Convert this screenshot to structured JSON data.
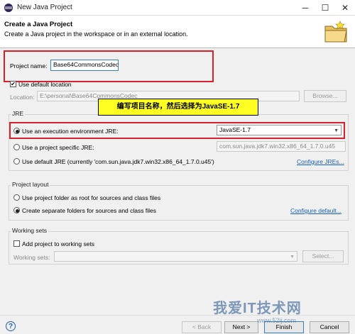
{
  "window": {
    "title": "New Java Project",
    "minimize": "─",
    "maximize": "☐",
    "close": "✕"
  },
  "header": {
    "title": "Create a Java Project",
    "description": "Create a Java project in the workspace or in an external location."
  },
  "project": {
    "name_label": "Project name:",
    "name_value": "Base64CommonsCodec",
    "use_default_location_label": "Use default location",
    "use_default_location_checked": true,
    "location_label": "Location:",
    "location_value": "E:\\personal\\Base64CommonsCodec",
    "browse_label": "Browse..."
  },
  "annotation": {
    "callout_text": "编写项目名称，然后选择为JavaSE-1.7"
  },
  "jre": {
    "group_label": "JRE",
    "options": [
      {
        "label": "Use an execution environment JRE:",
        "selected": true,
        "value": "JavaSE-1.7"
      },
      {
        "label": "Use a project specific JRE:",
        "selected": false,
        "value": "com.sun.java.jdk7.win32.x86_64_1.7.0.u45"
      },
      {
        "label": "Use default JRE (currently 'com.sun.java.jdk7.win32.x86_64_1.7.0.u45')",
        "selected": false
      }
    ],
    "configure_link": "Configure JREs..."
  },
  "layout": {
    "group_label": "Project layout",
    "options": [
      {
        "label": "Use project folder as root for sources and class files",
        "selected": false
      },
      {
        "label": "Create separate folders for sources and class files",
        "selected": true
      }
    ],
    "configure_link": "Configure default..."
  },
  "working_sets": {
    "group_label": "Working sets",
    "add_label": "Add project to working sets",
    "add_checked": false,
    "sets_label": "Working sets:",
    "select_label": "Select..."
  },
  "footer": {
    "back_label": "< Back",
    "next_label": "Next >",
    "finish_label": "Finish",
    "cancel_label": "Cancel"
  },
  "watermark": {
    "text": "我爱IT技术网",
    "url": "www.52ij.com"
  }
}
